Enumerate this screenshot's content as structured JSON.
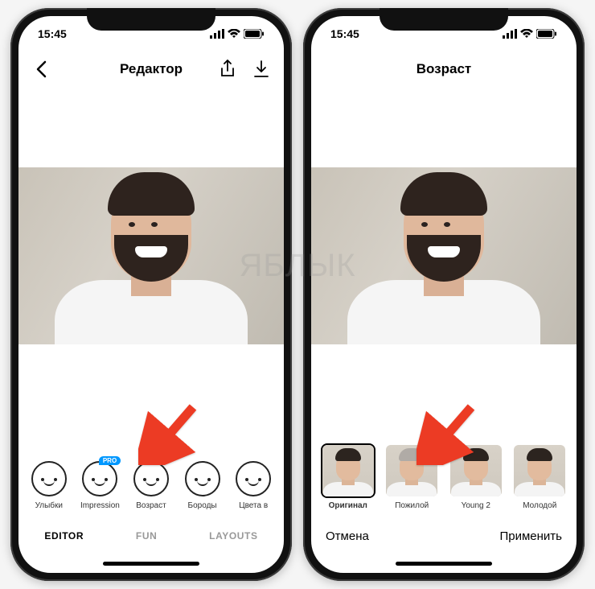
{
  "watermark": "ЯБЛЫК",
  "status": {
    "time": "15:45"
  },
  "left": {
    "nav": {
      "title": "Редактор"
    },
    "filters": {
      "items": [
        {
          "label": "Улыбки"
        },
        {
          "label": "Impression",
          "badge": "PRO"
        },
        {
          "label": "Возраст"
        },
        {
          "label": "Бороды"
        },
        {
          "label": "Цвета в"
        }
      ]
    },
    "tabs": {
      "editor": "EDITOR",
      "fun": "FUN",
      "layouts": "LAYOUTS"
    }
  },
  "right": {
    "nav": {
      "title": "Возраст"
    },
    "ages": {
      "items": [
        {
          "label": "Оригинал",
          "bold": true,
          "hair": "dark",
          "selected": true
        },
        {
          "label": "Пожилой",
          "hair": "gray"
        },
        {
          "label": "Young 2",
          "hair": "dark"
        },
        {
          "label": "Молодой",
          "hair": "dark"
        }
      ]
    },
    "actions": {
      "cancel": "Отмена",
      "apply": "Применить"
    }
  }
}
